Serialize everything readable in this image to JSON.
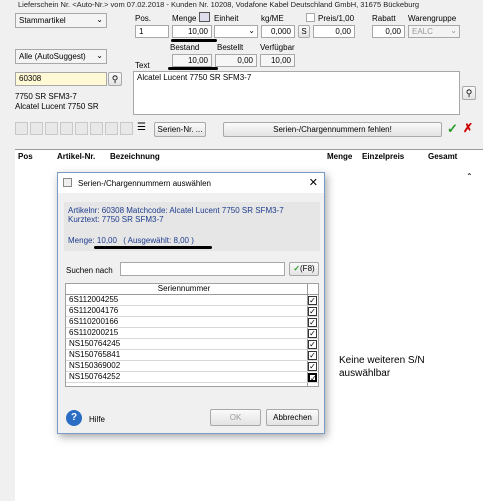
{
  "top_strip": "Lieferschein Nr. <Auto-Nr.> vom 07.02.2018 - Kunden Nr. 10208, Vodafone Kabel Deutschland GmbH, 31675 Bückeburg",
  "type_select": "Stammartikel",
  "suggest_select": "Alle (AutoSuggest)",
  "article_no": "60308",
  "article_line1": "7750 SR SFM3-7",
  "article_line2": "Alcatel Lucent 7750 SR",
  "headers": {
    "pos": "Pos.",
    "menge": "Menge",
    "einheit": "Einheit",
    "kg": "kg/ME",
    "s": "S",
    "preis": "Preis/1,00",
    "rabatt": "Rabatt",
    "warengruppe": "Warengruppe",
    "bestand": "Bestand",
    "bestellt": "Bestellt",
    "verfuegbar": "Verfügbar",
    "text": "Text"
  },
  "values": {
    "pos": "1",
    "menge": "10,00",
    "kg": "0,000",
    "s": "S",
    "preis": "0,00",
    "rabatt": "0,00",
    "warengruppe": "EALC",
    "bestand": "10,00",
    "bestellt": "0,00",
    "verfuegbar": "10,00"
  },
  "text_value": "Alcatel Lucent 7750 SR SFM3-7",
  "toolbar": {
    "serien_btn": "Serien-Nr. ...",
    "warning_btn": "Serien-/Chargennummern fehlen!"
  },
  "grid_headers": {
    "pos": "Pos",
    "artikel": "Artikel-Nr.",
    "bezeichnung": "Bezeichnung",
    "menge": "Menge",
    "einzelpreis": "Einzelpreis",
    "gesamt": "Gesamt"
  },
  "dialog": {
    "title": "Serien-/Chargennummern auswählen",
    "info_line1": "Artikelnr: 60308  Matchcode: Alcatel Lucent 7750 SR SFM3-7",
    "info_line2": "Kurztext: 7750 SR SFM3-7",
    "menge_label": "Menge:",
    "menge_value": "10,00",
    "ausgewaehlt": "( Ausgewählt: 8,00 )",
    "suchen_label": "Suchen nach",
    "f8_button": "(F8)",
    "col_header": "Seriennummer",
    "serials": [
      "6S112004255",
      "6S112004176",
      "6S110200166",
      "6S110200215",
      "NS150764245",
      "NS150765841",
      "NS150369002",
      "NS150764252"
    ],
    "help_label": "Hilfe",
    "ok_label": "OK",
    "cancel_label": "Abbrechen"
  },
  "annotation": {
    "line1": "Keine weiteren S/N",
    "line2": "auswählbar"
  }
}
